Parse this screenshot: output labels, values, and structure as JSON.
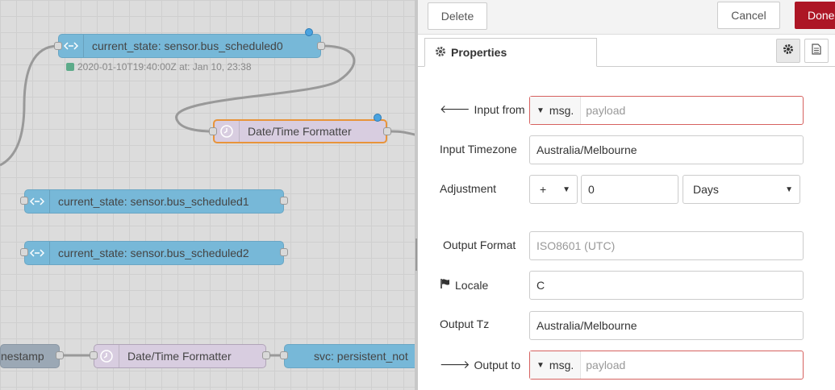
{
  "canvas": {
    "nodes": [
      {
        "label": "current_state: sensor.bus_scheduled0"
      },
      {
        "label": "Date/Time Formatter"
      },
      {
        "label": "current_state: sensor.bus_scheduled1"
      },
      {
        "label": "current_state: sensor.bus_scheduled2"
      },
      {
        "label": "nestamp"
      },
      {
        "label": "Date/Time Formatter"
      },
      {
        "label": "svc: persistent_not"
      }
    ],
    "status0": "2020-01-10T19:40:00Z at: Jan 10, 23:38"
  },
  "toolbar": {
    "delete_label": "Delete",
    "cancel_label": "Cancel",
    "done_label": "Done"
  },
  "tabs": {
    "properties_label": "Properties"
  },
  "form": {
    "input_from": {
      "label": "Input from",
      "type": "msg.",
      "value": "payload"
    },
    "input_timezone": {
      "label": "Input Timezone",
      "value": "Australia/Melbourne"
    },
    "adjustment": {
      "label": "Adjustment",
      "sign": "+",
      "amount": "0",
      "unit": "Days"
    },
    "output_format": {
      "label": "Output Format",
      "placeholder": "ISO8601 (UTC)"
    },
    "locale": {
      "label": "Locale",
      "value": "C"
    },
    "output_tz": {
      "label": "Output Tz",
      "value": "Australia/Melbourne"
    },
    "output_to": {
      "label": "Output to",
      "type": "msg.",
      "value": "payload"
    }
  },
  "colors": {
    "done": "#ad1625",
    "ha_node": "#77b8d8",
    "dt_node": "#d8cde0",
    "selected": "#e8943a"
  }
}
